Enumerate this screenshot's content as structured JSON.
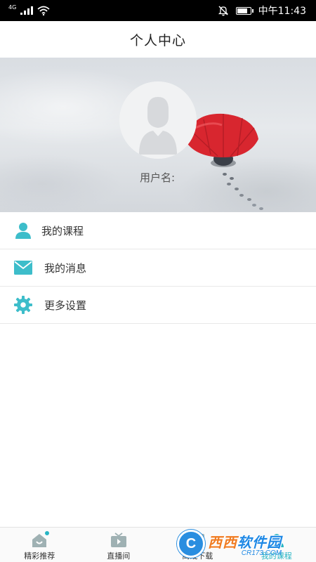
{
  "status_bar": {
    "network": "4G",
    "time": "中午11:43",
    "battery_level": 0.85,
    "icons": [
      "signal-icon",
      "wifi-icon",
      "mute-icon",
      "battery-icon"
    ]
  },
  "header": {
    "title": "个人中心"
  },
  "profile": {
    "username_label": "用户名:"
  },
  "menu": {
    "items": [
      {
        "label": "我的课程",
        "icon": "person-icon"
      },
      {
        "label": "我的消息",
        "icon": "mail-icon"
      },
      {
        "label": "更多设置",
        "icon": "gear-icon"
      }
    ]
  },
  "bottom_nav": {
    "items": [
      {
        "label": "精彩推荐",
        "icon": "home-icon"
      },
      {
        "label": "直播间",
        "icon": "tv-icon"
      },
      {
        "label": "离线下载",
        "icon": "download-icon"
      },
      {
        "label": "我的课程",
        "icon": "person-icon",
        "active": true
      }
    ]
  },
  "watermark": {
    "logo_letter": "C",
    "brand_a": "西西",
    "brand_b": "软件园",
    "site": "CR173.COM"
  },
  "colors": {
    "accent": "#27b5c4",
    "icon": "#3dbdca",
    "status_bar": "#000000"
  }
}
